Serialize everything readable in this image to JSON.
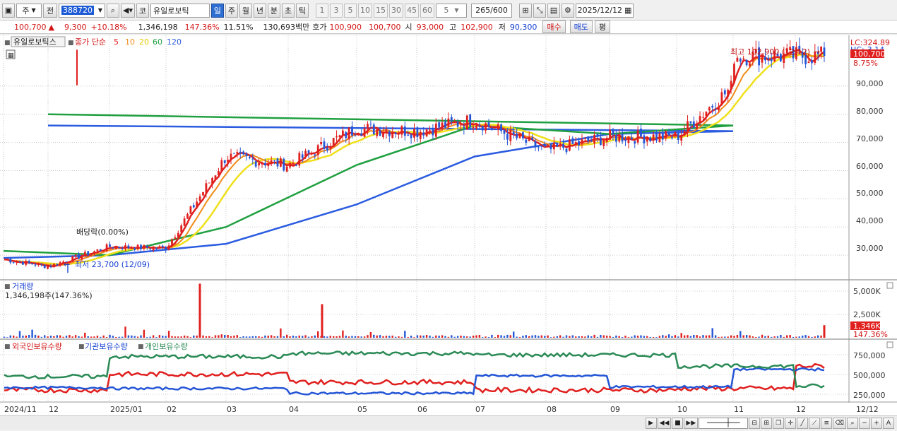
{
  "toolbar": {
    "market": "주",
    "period_mode": "전",
    "code": "388720",
    "stock_name": "유일로보틱",
    "timeframes": [
      "일",
      "주",
      "월",
      "년",
      "분",
      "초",
      "틱"
    ],
    "active_tf": "일",
    "intervals": [
      "1",
      "3",
      "5",
      "10",
      "15",
      "30",
      "45",
      "60"
    ],
    "sel_interval": "5",
    "range": "265/600",
    "date": "2025/12/12",
    "ko_tag": "코"
  },
  "quote": {
    "price": "100,700",
    "change": "9,300",
    "pct": "+10.18%",
    "volume": "1,346,198",
    "vol_ratio": "147.36%",
    "turnover": "11.51%",
    "amount": "130,693백만",
    "ask_label": "호가",
    "ask": "100,900",
    "bid": "100,700",
    "open_label": "시",
    "open": "93,000",
    "high_label": "고",
    "high": "102,900",
    "low_label": "저",
    "low": "90,300",
    "buy": "매수",
    "sell": "매도",
    "flat": "평"
  },
  "legend": {
    "name": "유일로보틱스",
    "ma_label": "종가 단순",
    "periods": [
      "5",
      "10",
      "20",
      "60",
      "120"
    ]
  },
  "annotations": {
    "high": "최고 102,900 (12/12)",
    "low": "최저 23,700 (12/09)",
    "div": "배당락(0.00%)"
  },
  "price_axis": {
    "ticks": [
      "90,000",
      "80,000",
      "70,000",
      "60,000",
      "50,000",
      "40,000",
      "30,000"
    ],
    "lc": "LC:324.89",
    "hc": "HC:-3.14",
    "cur": "100,700",
    "cur_pct": "8.75%"
  },
  "volume": {
    "title": "거래량",
    "value": "1,346,198주(147.36%)",
    "ticks": [
      "5,000K",
      "2,500K"
    ],
    "cur": "1,346K",
    "cur_pct": "147.36%"
  },
  "holders": {
    "labels": [
      "외국인보유수량",
      "기관보유수량",
      "개인보유수량"
    ],
    "ticks": [
      "750,000",
      "500,000",
      "250,000"
    ]
  },
  "xaxis": {
    "labels": [
      "2024/11",
      "12",
      "2025/01",
      "02",
      "03",
      "04",
      "05",
      "06",
      "07",
      "08",
      "09",
      "10",
      "11",
      "12"
    ],
    "right": "12/12"
  },
  "colors": {
    "up": "#e0201f",
    "down": "#2456d6",
    "ma5": "#e02020",
    "ma10": "#f08c1a",
    "ma20": "#f0e01a",
    "ma60": "#20a040",
    "ma120": "#2b5ce0"
  },
  "chart_data": {
    "type": "candlestick",
    "price_ylim": [
      22000,
      106000
    ],
    "close_by_month": [
      {
        "x": "2024/11",
        "value": 28500
      },
      {
        "x": "12",
        "value": 26000
      },
      {
        "x": "2025/01",
        "value": 33000
      },
      {
        "x": "02",
        "value": 32500
      },
      {
        "x": "03",
        "value": 65000
      },
      {
        "x": "04",
        "value": 62000
      },
      {
        "x": "05",
        "value": 75000
      },
      {
        "x": "06",
        "value": 74000
      },
      {
        "x": "07",
        "value": 78000
      },
      {
        "x": "08",
        "value": 67000
      },
      {
        "x": "09",
        "value": 72000
      },
      {
        "x": "10",
        "value": 72000
      },
      {
        "x": "11",
        "value": 90000
      },
      {
        "x": "12",
        "value": 100700
      }
    ],
    "ma120_by_month": [
      {
        "x": "2024/11",
        "value": 29000
      },
      {
        "x": "2025/01",
        "value": 30000
      },
      {
        "x": "03",
        "value": 34000
      },
      {
        "x": "05",
        "value": 48000
      },
      {
        "x": "07",
        "value": 65000
      },
      {
        "x": "09",
        "value": 73000
      },
      {
        "x": "11",
        "value": 74000
      },
      {
        "x": "12",
        "value": 76000
      }
    ],
    "ma60_by_month": [
      {
        "x": "2024/11",
        "value": 31500
      },
      {
        "x": "2025/01",
        "value": 30000
      },
      {
        "x": "03",
        "value": 40000
      },
      {
        "x": "05",
        "value": 62000
      },
      {
        "x": "07",
        "value": 76000
      },
      {
        "x": "09",
        "value": 73000
      },
      {
        "x": "11",
        "value": 76000
      },
      {
        "x": "12",
        "value": 80000
      }
    ],
    "high": {
      "x": "12/12",
      "value": 102900
    },
    "low": {
      "x": "12/09",
      "value": 23700
    },
    "volume_peaks_k": [
      {
        "x": "02",
        "value": 5800
      },
      {
        "x": "04",
        "value": 3600
      },
      {
        "x": "12/12",
        "value": 1346
      }
    ],
    "holders_series": [
      {
        "name": "외국인보유수량",
        "color": "#e0201f"
      },
      {
        "name": "기관보유수량",
        "color": "#2456d6"
      },
      {
        "name": "개인보유수량",
        "color": "#2a8a55"
      }
    ]
  }
}
